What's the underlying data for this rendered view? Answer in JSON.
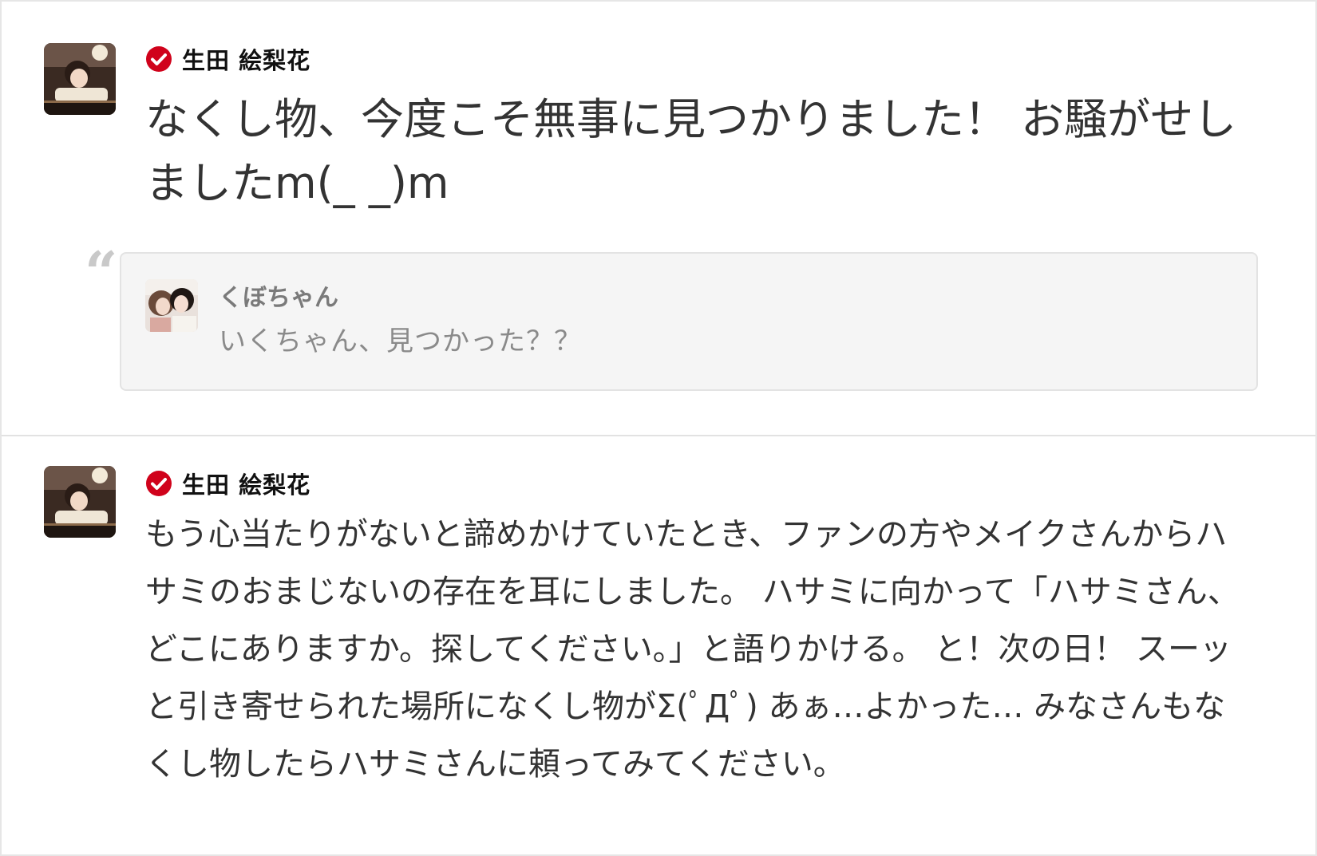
{
  "posts": [
    {
      "author": "生田 絵梨花",
      "verified_icon": "verified-check-icon",
      "text_lines": [
        "なくし物、今度こそ無事に見つかりました！ お騒がせし",
        "ましたm(_ _)m"
      ],
      "quoted": {
        "author": "くぼちゃん",
        "text": "いくちゃん、見つかった？？"
      }
    },
    {
      "author": "生田 絵梨花",
      "verified_icon": "verified-check-icon",
      "text_lines": [
        "もう心当たりがないと諦めかけていたとき、ファンの方やメイクさんからハ",
        "サミのおまじないの存在を耳にしました。 ハサミに向かって「ハサミさん、",
        "どこにありますか。探してください。」と語りかける。 と！次の日！ スーッ",
        "と引き寄せられた場所になくし物がΣ(ﾟДﾟ) あぁ…よかった… みなさんもな",
        "くし物したらハサミさんに頼ってみてください。"
      ]
    }
  ],
  "colors": {
    "verified_red": "#d0021b",
    "text": "#333333",
    "quote_bg": "#f5f5f5"
  }
}
